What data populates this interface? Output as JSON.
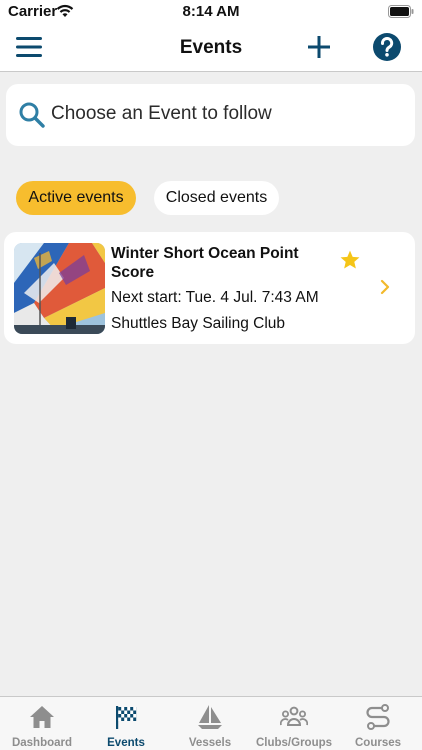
{
  "status_bar": {
    "carrier": "Carrier",
    "time": "8:14 AM"
  },
  "nav": {
    "title": "Events"
  },
  "search": {
    "placeholder": "Choose an Event to follow"
  },
  "filters": {
    "active": "Active events",
    "closed": "Closed events"
  },
  "event": {
    "title": "Winter Short Ocean Point Score",
    "next_start": "Next start: Tue. 4 Jul. 7:43 AM",
    "club": "Shuttles Bay Sailing Club",
    "favorited": true
  },
  "tabs": [
    {
      "label": "Dashboard",
      "icon": "home-icon"
    },
    {
      "label": "Events",
      "icon": "checkered-flag-icon",
      "active": true
    },
    {
      "label": "Vessels",
      "icon": "sailboat-icon"
    },
    {
      "label": "Clubs/Groups",
      "icon": "group-icon"
    },
    {
      "label": "Courses",
      "icon": "route-icon"
    }
  ],
  "colors": {
    "primary": "#0c4a6e",
    "accent": "#f7bd2e",
    "background": "#efefef"
  }
}
